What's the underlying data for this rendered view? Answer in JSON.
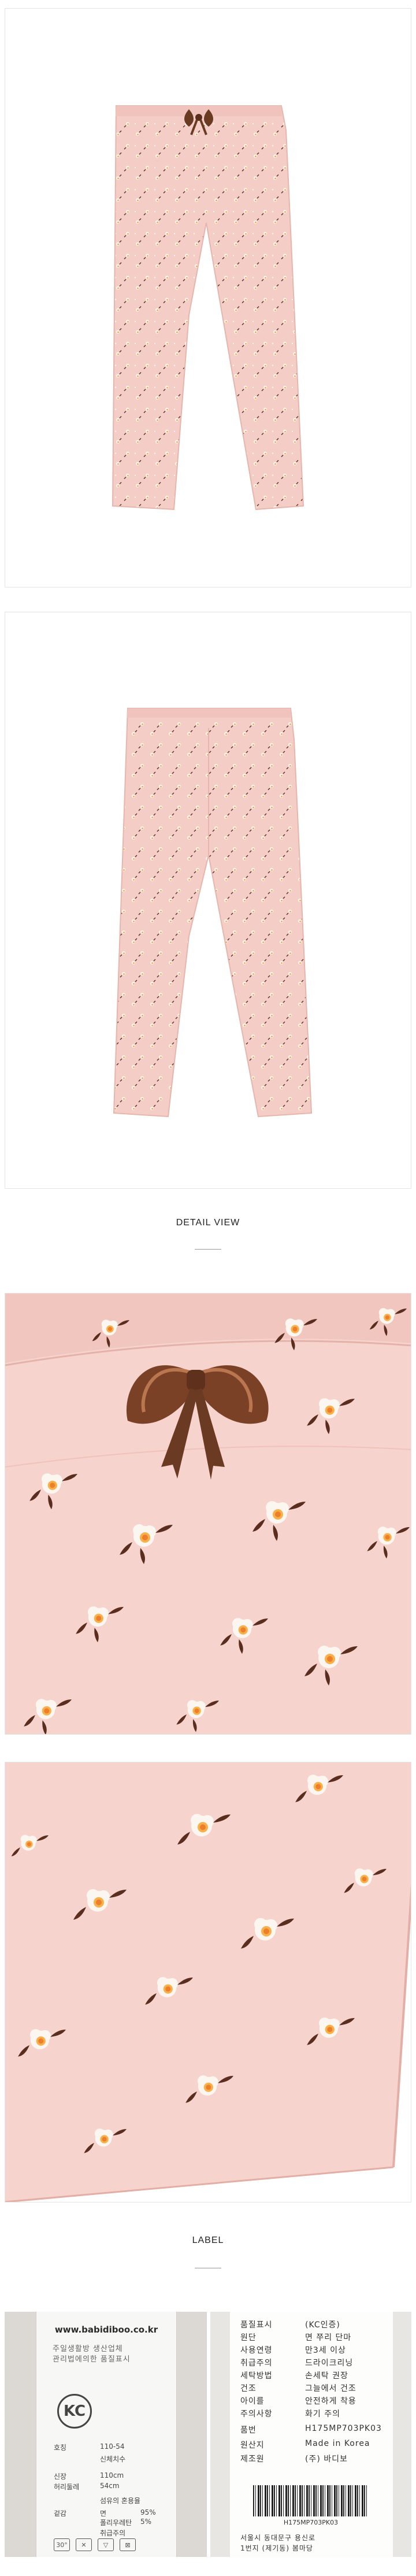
{
  "sections": {
    "detail_heading": "DETAIL VIEW",
    "label_heading": "LABEL"
  },
  "colors": {
    "fabric_pink": "#f3cdc6",
    "ribbon_brown": "#6b3a22",
    "leaf_brown": "#5a2e1f",
    "flower_white": "#fbf6ef",
    "flower_center": "#f39a3a"
  },
  "images": {
    "front_view": "pink-floral-leggings-front",
    "back_view": "pink-floral-leggings-back",
    "closeup_waist": "waistband-bow-closeup",
    "closeup_hem": "leg-hem-closeup"
  },
  "care_label": {
    "url": "www.babidiboo.co.kr",
    "maker_lines": [
      "주일생활방 생산업체",
      "관리법에의한 품질표시"
    ],
    "kc_mark": "KC",
    "style_label": "호칭",
    "style_value": "110-54",
    "body_label": "신체치수",
    "height_label": "신장",
    "height_value": "110cm",
    "waist_label": "허리둘레",
    "waist_value": "54cm",
    "fiber_title": "섬유의 혼용율",
    "fiber_rows": [
      {
        "label": "겉감",
        "name": "면",
        "value": "95%"
      },
      {
        "label": "",
        "name": "폴리우레탄",
        "value": "5%"
      }
    ],
    "care_note": "취급주의",
    "care_icons": [
      "30°",
      "✕",
      "▽",
      "⊠"
    ]
  },
  "tag_label": {
    "lines": [
      {
        "k": "품질표시",
        "v": "(KC인증)"
      },
      {
        "k": "원단",
        "v": "면 쭈리 단마"
      },
      {
        "k": "사용연령",
        "v": "만3세 이상"
      },
      {
        "k": "취급주의",
        "v": "드라이크리닝"
      },
      {
        "k": "세탁방법",
        "v": "손세탁 권장"
      },
      {
        "k": "건조",
        "v": "그늘에서 건조"
      },
      {
        "k": "아이를",
        "v": "안전하게 착용"
      },
      {
        "k": "주의사항",
        "v": "화기 주의"
      }
    ],
    "model_label": "품번",
    "model_value": "H175MP703PK03",
    "origin_label": "원산지",
    "origin_value": "Made in Korea",
    "vendor_label": "제조원",
    "vendor_value": "(주) 바디보",
    "address_lines": [
      "서울시 동대문구 용신로",
      "1번지 (제기동) 봄마당"
    ]
  }
}
